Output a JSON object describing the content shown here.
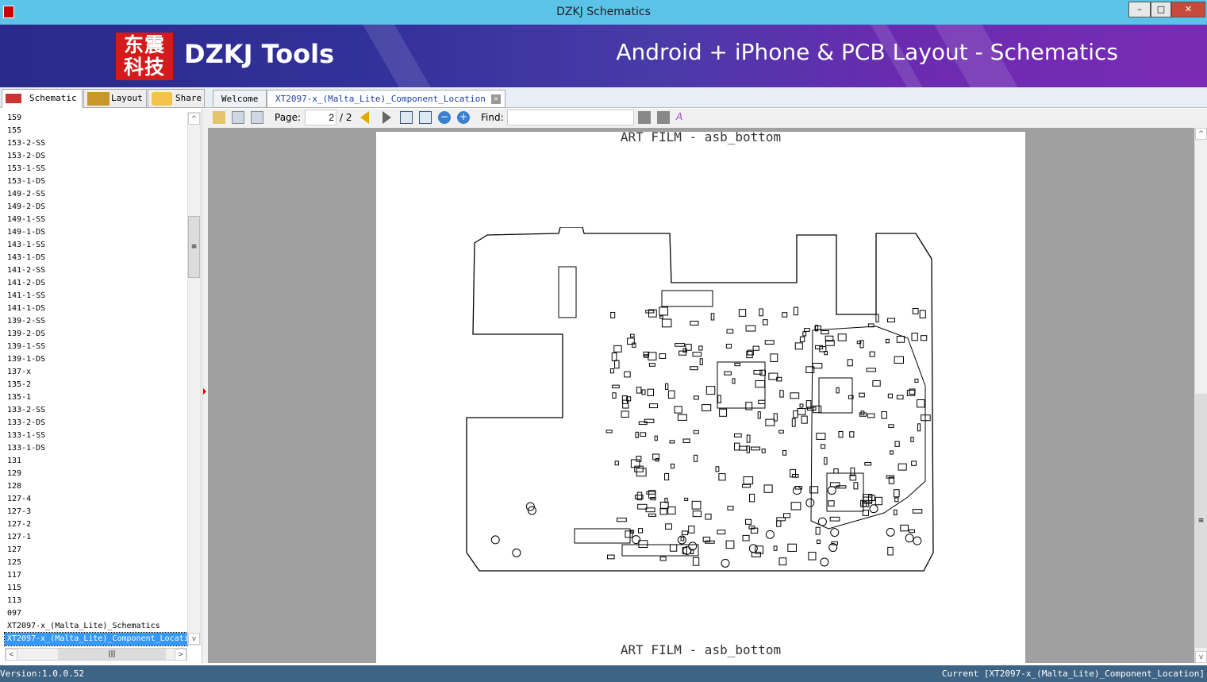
{
  "window": {
    "title": "DZKJ Schematics",
    "minimize": "–",
    "maximize": "□",
    "close": "✕"
  },
  "banner": {
    "logo_text": "东震科技",
    "brand": "DZKJ Tools",
    "tagline": "Android + iPhone & PCB Layout - Schematics"
  },
  "left_tabs": [
    {
      "label": "Schematic",
      "icon": "pdf-icon"
    },
    {
      "label": "Layout",
      "icon": "pads-icon"
    },
    {
      "label": "Share",
      "icon": "cloud-folder-icon"
    }
  ],
  "doc_tabs": [
    {
      "label": "Welcome"
    },
    {
      "label": "XT2097-x_(Malta_Lite)_Component_Location"
    }
  ],
  "file_list": [
    "159",
    "155",
    "153-2-SS",
    "153-2-DS",
    "153-1-SS",
    "153-1-DS",
    "149-2-SS",
    "149-2-DS",
    "149-1-SS",
    "149-1-DS",
    "143-1-SS",
    "143-1-DS",
    "141-2-SS",
    "141-2-DS",
    "141-1-SS",
    "141-1-DS",
    "139-2-SS",
    "139-2-DS",
    "139-1-SS",
    "139-1-DS",
    "137-x",
    "135-2",
    "135-1",
    "133-2-SS",
    "133-2-DS",
    "133-1-SS",
    "133-1-DS",
    "131",
    "129",
    "128",
    "127-4",
    "127-3",
    "127-2",
    "127-1",
    "127",
    "125",
    "117",
    "115",
    "113",
    "097",
    "XT2097-x_(Malta_Lite)_Schematics",
    "XT2097-x_(Malta_Lite)_Component_Location"
  ],
  "selected_index": 41,
  "toolbar": {
    "page_label": "Page:",
    "page_value": "2",
    "page_total": "/ 2",
    "find_label": "Find:",
    "find_value": ""
  },
  "page": {
    "title_top": "ART FILM - asb_bottom",
    "title_bottom": "ART FILM - asb_bottom"
  },
  "status": {
    "version": "Version:1.0.0.52",
    "current": "Current [XT2097-x_(Malta_Lite)_Component_Location]"
  }
}
